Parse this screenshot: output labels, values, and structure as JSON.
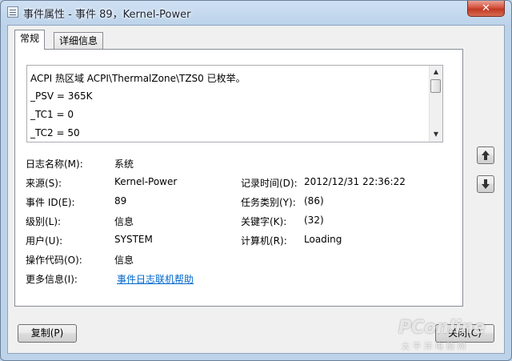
{
  "window": {
    "title": "事件属性 - 事件 89，Kernel-Power",
    "close_label": "✕"
  },
  "tabs": [
    {
      "label": "常规",
      "active": true
    },
    {
      "label": "详细信息",
      "active": false
    }
  ],
  "description": {
    "lines": [
      "ACPI 热区域 ACPI\\ThermalZone\\TZS0 已枚举。",
      "_PSV = 365K",
      "_TC1 = 0",
      "_TC2 = 50"
    ]
  },
  "fields": {
    "log_name": {
      "label": "日志名称(M):",
      "value": "系统"
    },
    "source": {
      "label": "来源(S):",
      "value": "Kernel-Power"
    },
    "logged": {
      "label": "记录时间(D):",
      "value": "2012/12/31 22:36:22"
    },
    "event_id": {
      "label": "事件 ID(E):",
      "value": "89"
    },
    "task_category": {
      "label": "任务类别(Y):",
      "value": "(86)"
    },
    "level": {
      "label": "级别(L):",
      "value": "信息"
    },
    "keywords": {
      "label": "关键字(K):",
      "value": "(32)"
    },
    "user": {
      "label": "用户(U):",
      "value": "SYSTEM"
    },
    "computer": {
      "label": "计算机(R):",
      "value": "Loading"
    },
    "opcode": {
      "label": "操作代码(O):",
      "value": "信息"
    },
    "more_info": {
      "label": "更多信息(I):",
      "link": "事件日志联机帮助"
    }
  },
  "side_buttons": {
    "up_icon": "up-arrow-icon",
    "down_icon": "down-arrow-icon"
  },
  "buttons": {
    "copy": "复制(P)",
    "close": "关闭(C)"
  },
  "watermark": {
    "brand": "PConline",
    "sub": "太平洋电脑网"
  }
}
